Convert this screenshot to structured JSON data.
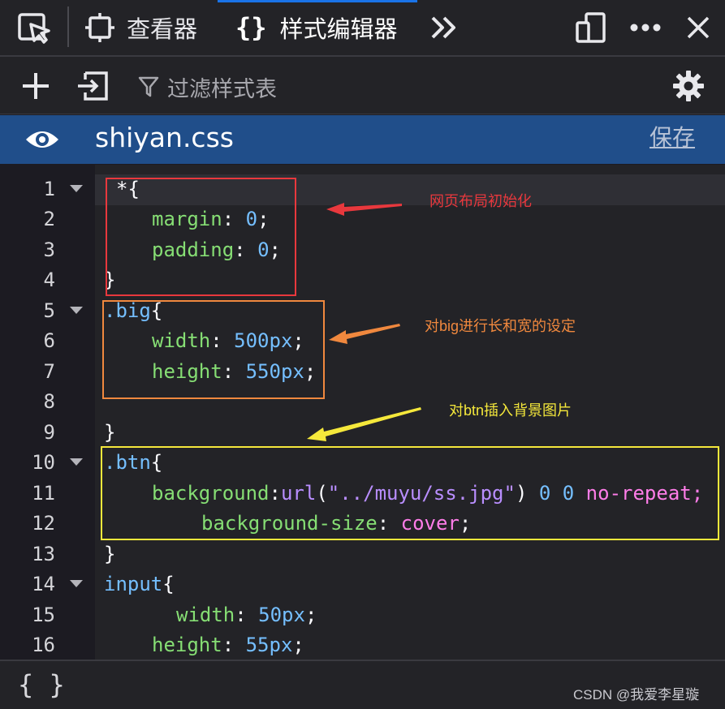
{
  "toolbar": {
    "picker_icon": "element-picker-icon",
    "inspector_tab": {
      "label": "查看器",
      "icon": "inspector-icon"
    },
    "style_editor_tab": {
      "label": "样式编辑器",
      "icon": "braces-icon"
    },
    "overflow_icon": "double-chevron-right-icon",
    "responsive_icon": "responsive-design-icon",
    "menu_icon": "more-horizontal-icon",
    "close_icon": "close-icon",
    "active_color": "#1a73e8"
  },
  "filterbar": {
    "add_icon": "plus-icon",
    "import_icon": "import-icon",
    "filter_icon": "filter-icon",
    "filter_placeholder": "过滤样式表",
    "settings_icon": "gear-icon"
  },
  "file": {
    "visibility_icon": "eye-icon",
    "name": "shiyan.css",
    "save_label": "保存",
    "header_color": "#204e8a"
  },
  "editor": {
    "lines": [
      {
        "n": "1"
      },
      {
        "n": "2"
      },
      {
        "n": "3"
      },
      {
        "n": "4"
      },
      {
        "n": "5"
      },
      {
        "n": "6"
      },
      {
        "n": "7"
      },
      {
        "n": "8"
      },
      {
        "n": "9"
      },
      {
        "n": "10"
      },
      {
        "n": "11"
      },
      {
        "n": "12"
      },
      {
        "n": "13"
      },
      {
        "n": "14"
      },
      {
        "n": "15"
      },
      {
        "n": "16"
      }
    ],
    "tokens": {
      "l1_sel": "*",
      "l1_brace": "{",
      "l2_prop": "margin",
      "l2_val": "0",
      "l3_prop": "padding",
      "l3_val": "0",
      "l4_brace": "}",
      "l5_sel": ".big",
      "l5_brace": "{",
      "l6_prop": "width",
      "l6_val": "500px",
      "l7_prop": "height",
      "l7_val": "550px",
      "l9_brace": "}",
      "l10_sel": ".btn",
      "l10_brace": "{",
      "l11_prop": "background",
      "l11_fn": "url",
      "l11_str": "\"../muyu/ss.jpg\"",
      "l11_n1": "0",
      "l11_n2": "0",
      "l11_kw": "no-repeat;",
      "l12_prop": "background-size",
      "l12_kw": "cover",
      "l13_brace": "}",
      "l14_sel": "input",
      "l14_brace": "{",
      "l15_prop": "width",
      "l15_val": "50px",
      "l16_prop": "height",
      "l16_val": "55px"
    }
  },
  "annotations": {
    "init": {
      "text": "网页布局初始化",
      "color": "#e8383d"
    },
    "big": {
      "text": "对big进行长和宽的设定",
      "color": "#f0883e"
    },
    "btn": {
      "text": "对btn插入背景图片",
      "color": "#f5e83b"
    }
  },
  "bottombar": {
    "braces_icon": "pretty-print-braces-icon",
    "watermark": "CSDN @我爱李星璇"
  }
}
